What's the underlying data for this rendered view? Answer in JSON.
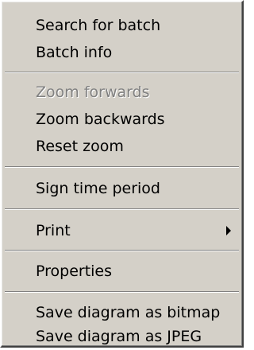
{
  "context_menu": {
    "items": [
      {
        "label": "Search for batch",
        "enabled": true
      },
      {
        "label": "Batch info",
        "enabled": true
      },
      {
        "label": "Zoom forwards",
        "enabled": false
      },
      {
        "label": "Zoom backwards",
        "enabled": true
      },
      {
        "label": "Reset zoom",
        "enabled": true
      },
      {
        "label": "Sign time period",
        "enabled": true
      },
      {
        "label": "Print",
        "enabled": true,
        "submenu": true
      },
      {
        "label": "Properties",
        "enabled": true
      },
      {
        "label": "Save diagram as bitmap",
        "enabled": true
      },
      {
        "label": "Save diagram as JPEG",
        "enabled": true
      }
    ],
    "colors": {
      "background": "#d4d0c8",
      "text": "#000000",
      "disabled_text": "#808080",
      "separator_dark": "#808080",
      "separator_light": "#ffffff"
    }
  }
}
